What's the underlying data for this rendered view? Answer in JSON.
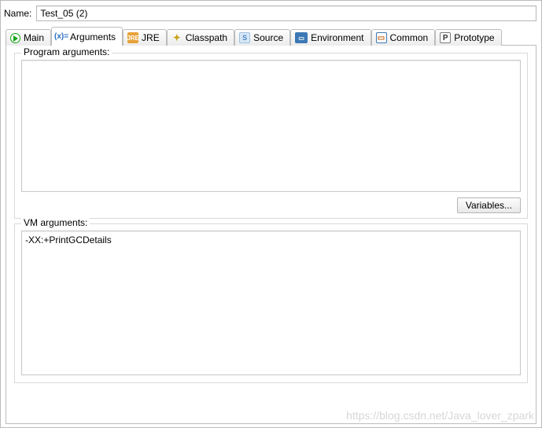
{
  "name_label": "Name:",
  "name_value": "Test_05 (2)",
  "tabs": [
    {
      "id": "main",
      "label": "Main"
    },
    {
      "id": "arguments",
      "label": "Arguments"
    },
    {
      "id": "jre",
      "label": "JRE"
    },
    {
      "id": "classpath",
      "label": "Classpath"
    },
    {
      "id": "source",
      "label": "Source"
    },
    {
      "id": "environment",
      "label": "Environment"
    },
    {
      "id": "common",
      "label": "Common"
    },
    {
      "id": "prototype",
      "label": "Prototype"
    }
  ],
  "active_tab": "arguments",
  "program_args": {
    "title": "Program arguments:",
    "value": "",
    "variables_btn": "Variables..."
  },
  "vm_args": {
    "title": "VM arguments:",
    "value": "-XX:+PrintGCDetails"
  },
  "watermark": "https://blog.csdn.net/Java_lover_zpark"
}
